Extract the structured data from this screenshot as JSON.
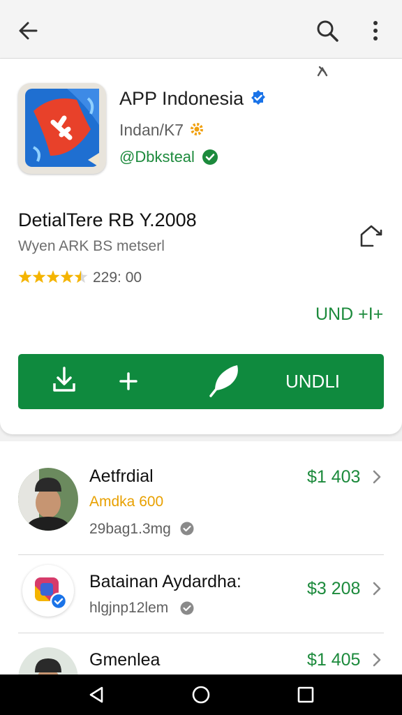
{
  "app": {
    "name": "APP Indonesia",
    "developer": "Indan/K7",
    "handle": "@Dbksteal"
  },
  "details": {
    "title": "DetialTere RB Y.2008",
    "subtitle": "Wyen ARK  BS metserl",
    "rating_stars": 4.5,
    "rating_count": "229: 00",
    "link_label": "UND +I+"
  },
  "action_bar": {
    "primary_label": "UNDLI"
  },
  "list": {
    "items": [
      {
        "title": "Aetfrdial",
        "subtitle": "Amdka 600",
        "meta": "29bag1.3mg",
        "price": "$1 403"
      },
      {
        "title": "Batainan Aydardha:",
        "meta": "hlgjnp12lem",
        "price": "$3 208"
      },
      {
        "title": "Gmenlea",
        "price": "$1 405"
      }
    ]
  },
  "colors": {
    "accent_green": "#0f8a3e",
    "price_green": "#1c8a3c",
    "verified_blue": "#1a73e8",
    "star_gold": "#f4b400",
    "subtitle_orange": "#e8a000"
  },
  "icons": {
    "appbar": [
      "back-arrow-icon",
      "search-icon",
      "more-vert-icon"
    ],
    "navbar": [
      "back-triangle-icon",
      "home-circle-icon",
      "recents-square-icon"
    ]
  }
}
